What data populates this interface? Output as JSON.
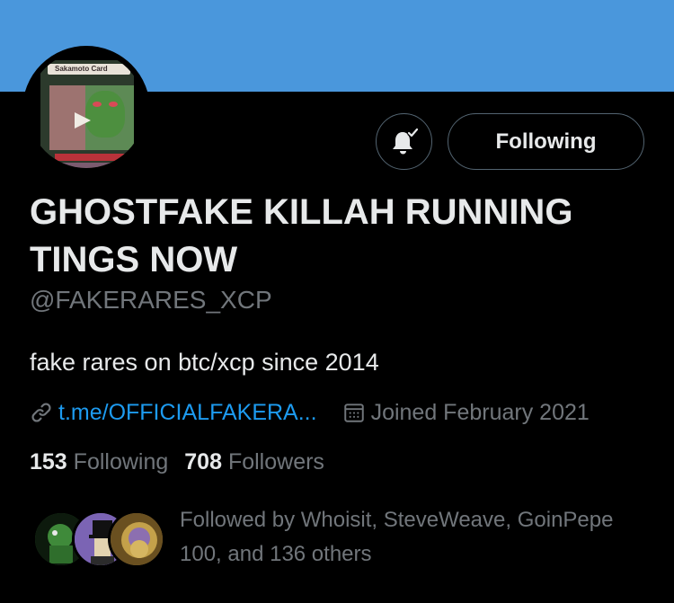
{
  "profile": {
    "display_name": "GHOSTFAKE KILLAH RUNNING TINGS NOW",
    "handle": "@FAKERARES_XCP",
    "bio": "fake rares on btc/xcp since 2014",
    "link": "t.me/OFFICIALFAKERA...",
    "joined": "Joined February 2021",
    "avatar_card_title": "Sakamoto Card"
  },
  "actions": {
    "notifications_icon": "bell-check-icon",
    "following_label": "Following"
  },
  "stats": {
    "following_count": "153",
    "following_label": "Following",
    "followers_count": "708",
    "followers_label": "Followers"
  },
  "followed_by": {
    "text": "Followed by Whoisit, SteveWeave, GoinPepe 100, and 136 others"
  },
  "colors": {
    "banner": "#4a97dc",
    "background": "#000000",
    "link": "#1d9bf0",
    "secondary_text": "#71767b",
    "primary_text": "#e7e9ea"
  }
}
